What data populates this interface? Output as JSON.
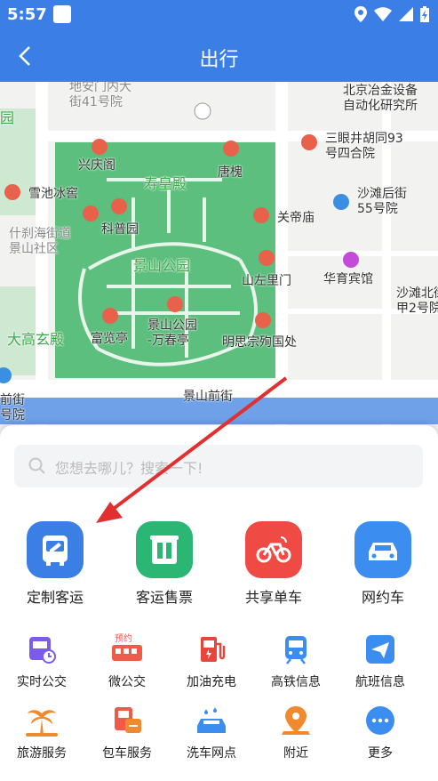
{
  "status": {
    "time": "5:57"
  },
  "header": {
    "title": "出行"
  },
  "map": {
    "labels": {
      "dianmen": "地安门内大\n街41号院",
      "yejin": "北京冶金设备\n自动化研究所",
      "yuan": "园",
      "sanyan": "三眼井胡同93\n号四合院",
      "xingqingge": "兴庆阁",
      "shouhuangdian": "寿皇殿",
      "tanghuai": "唐槐",
      "xuechi": "雪池冰窖",
      "shatan": "沙滩后街\n55号院",
      "guandimiao": "关帝庙",
      "kepuyuan": "科普园",
      "shichahai": "什刹海街道\n景山社区",
      "jingshan": "景山公园",
      "huayu": "华育宾馆",
      "shatanbei": "沙滩北街\n甲2号院",
      "shanzuo": "山左里门",
      "dagaoxuan": "大高玄殿",
      "fulanting": "富览亭",
      "wanchunting": "景山公园\n-万春亭",
      "mingsizong": "明思宗殉国处",
      "qianjie": "景山前街",
      "qianjie_left": "前街\n号院"
    }
  },
  "search": {
    "placeholder": "您想去哪儿？搜索一下!"
  },
  "main_services": [
    {
      "label": "定制客运"
    },
    {
      "label": "客运售票"
    },
    {
      "label": "共享单车"
    },
    {
      "label": "网约车"
    }
  ],
  "services": [
    {
      "label": "实时公交"
    },
    {
      "label": "微公交",
      "badge": "预约"
    },
    {
      "label": "加油充电"
    },
    {
      "label": "高铁信息"
    },
    {
      "label": "航班信息"
    },
    {
      "label": "旅游服务"
    },
    {
      "label": "包车服务"
    },
    {
      "label": "洗车网点"
    },
    {
      "label": "附近"
    },
    {
      "label": "更多"
    }
  ],
  "colors": {
    "primary": "#3b7fe6",
    "park": "#5cbf7d",
    "arrow": "#e03030"
  }
}
